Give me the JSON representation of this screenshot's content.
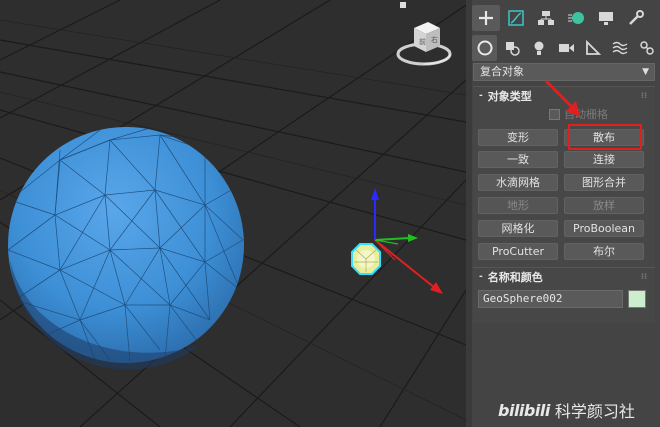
{
  "viewport": {
    "top_marker": "▪"
  },
  "panel": {
    "main_tabs": [
      "create-icon",
      "modify-icon",
      "hierarchy-icon",
      "motion-icon",
      "display-icon",
      "utilities-icon"
    ],
    "sub_tabs": [
      "geometry-icon",
      "shapes-icon",
      "lights-icon",
      "cameras-icon",
      "helpers-icon",
      "spacewarps-icon",
      "systems-icon"
    ],
    "category_select": {
      "value": "复合对象",
      "options": [
        "复合对象"
      ]
    },
    "object_type": {
      "title": "对象类型",
      "toggle": "-",
      "autogrid_label": "自动栅格",
      "buttons": [
        {
          "label": "变形",
          "enabled": true
        },
        {
          "label": "散布",
          "enabled": true
        },
        {
          "label": "一致",
          "enabled": true
        },
        {
          "label": "连接",
          "enabled": true
        },
        {
          "label": "水滴网格",
          "enabled": true
        },
        {
          "label": "图形合并",
          "enabled": true
        },
        {
          "label": "地形",
          "enabled": false
        },
        {
          "label": "放样",
          "enabled": false
        },
        {
          "label": "网格化",
          "enabled": true
        },
        {
          "label": "ProBoolean",
          "enabled": true
        },
        {
          "label": "ProCutter",
          "enabled": true
        },
        {
          "label": "布尔",
          "enabled": true
        }
      ]
    },
    "name_color": {
      "title": "名称和颜色",
      "toggle": "-",
      "name_value": "GeoSphere002",
      "object_color": "#cceecc"
    }
  },
  "watermark": {
    "logo": "bilibili",
    "channel": "科学颜习社"
  },
  "colors": {
    "sphere": "#3d8fd6",
    "highlight": "#e02020",
    "panel_bg": "#444444",
    "viewport_bg": "#2e2e2e"
  }
}
